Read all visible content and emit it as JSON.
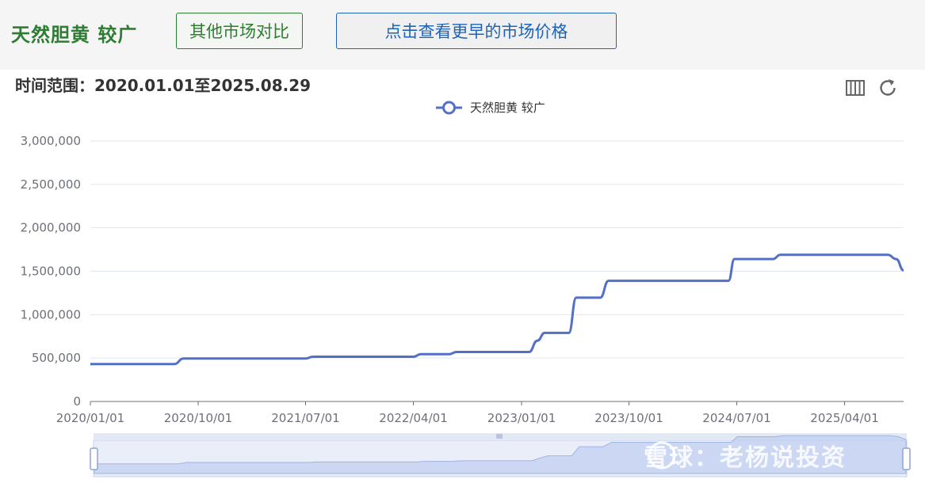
{
  "header": {
    "product_title": "天然胆黄 较广",
    "compare_button": "其他市场对比",
    "earlier_button": "点击查看更早的市场价格"
  },
  "time_range": "时间范围：2020.01.01至2025.08.29",
  "toolbar": {
    "data_view_icon": "data-view-icon",
    "restore_icon": "restore-icon"
  },
  "watermark": "雪球：老杨说投资",
  "colors": {
    "series": "#5470c6",
    "title": "#2e7d32",
    "button_blue": "#1e63b6"
  },
  "chart_data": {
    "type": "line",
    "title": "",
    "xlabel": "",
    "ylabel": "",
    "legend": [
      "天然胆黄 较广"
    ],
    "legend_position": "top-center",
    "grid": true,
    "ylim": [
      0,
      3000000
    ],
    "yticks": [
      "0",
      "500,000",
      "1,000,000",
      "1,500,000",
      "2,000,000",
      "2,500,000",
      "3,000,000"
    ],
    "xticks": [
      "2020/01/01",
      "2020/10/01",
      "2021/07/01",
      "2022/04/01",
      "2023/01/01",
      "2023/10/01",
      "2024/07/01",
      "2025/04/01"
    ],
    "xlim": [
      "2020-01-01",
      "2025-08-29"
    ],
    "series": [
      {
        "name": "天然胆黄 较广",
        "points": [
          [
            "2020-01-01",
            430000
          ],
          [
            "2020-08-01",
            430000
          ],
          [
            "2020-08-25",
            495000
          ],
          [
            "2021-07-01",
            495000
          ],
          [
            "2021-07-20",
            515000
          ],
          [
            "2022-04-01",
            515000
          ],
          [
            "2022-04-20",
            545000
          ],
          [
            "2022-07-01",
            545000
          ],
          [
            "2022-07-20",
            570000
          ],
          [
            "2023-01-20",
            570000
          ],
          [
            "2023-02-10",
            700000
          ],
          [
            "2023-03-01",
            790000
          ],
          [
            "2023-05-01",
            790000
          ],
          [
            "2023-05-20",
            1195000
          ],
          [
            "2023-07-20",
            1195000
          ],
          [
            "2023-08-10",
            1390000
          ],
          [
            "2024-06-10",
            1390000
          ],
          [
            "2024-06-25",
            1640000
          ],
          [
            "2024-10-01",
            1640000
          ],
          [
            "2024-10-20",
            1690000
          ],
          [
            "2025-07-20",
            1690000
          ],
          [
            "2025-08-10",
            1640000
          ],
          [
            "2025-08-29",
            1510000
          ]
        ]
      }
    ]
  }
}
